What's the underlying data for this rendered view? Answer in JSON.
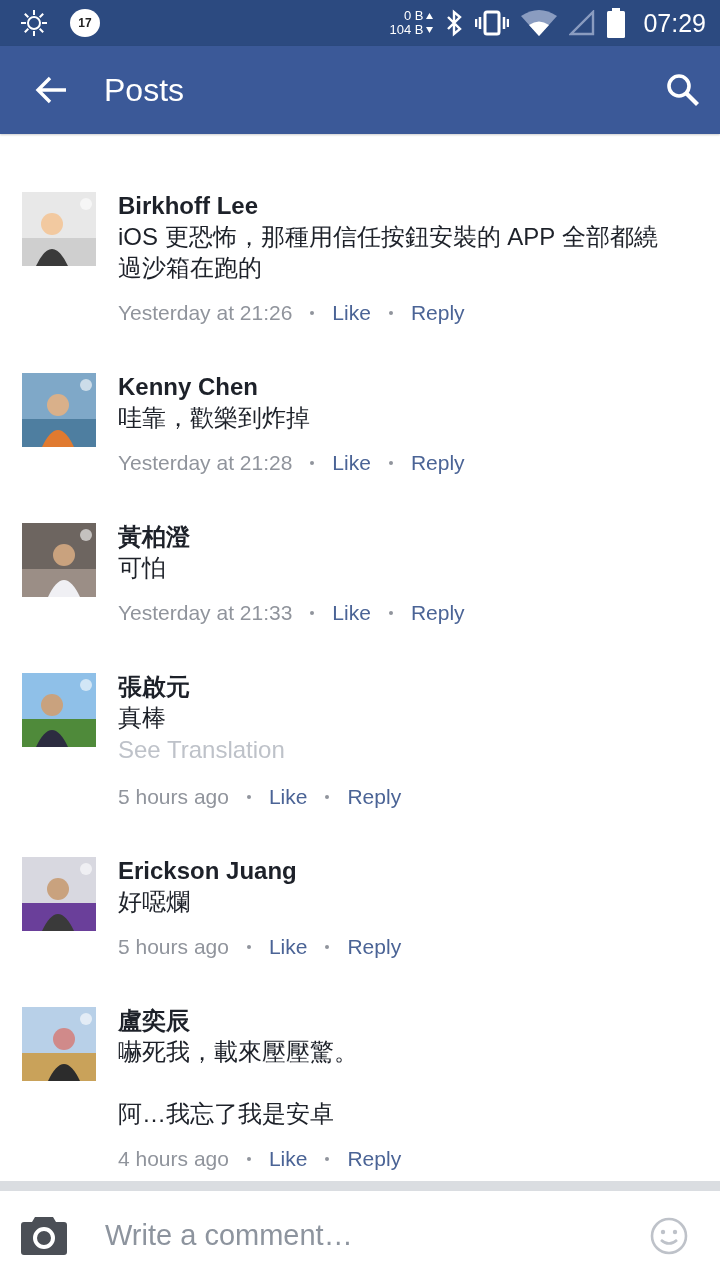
{
  "status_bar": {
    "notification_count": "17",
    "upload": "0 B",
    "download": "104 B",
    "time": "07:29"
  },
  "app_bar": {
    "title": "Posts"
  },
  "comments": [
    {
      "author": "Birkhoff Lee",
      "paragraphs": [
        "iOS 更恐怖，那種用信任按鈕安裝的 APP 全部都繞過沙箱在跑的"
      ],
      "time": "Yesterday at 21:26",
      "like": "Like",
      "reply": "Reply"
    },
    {
      "author": "Kenny Chen",
      "paragraphs": [
        "哇靠，歡樂到炸掉"
      ],
      "time": "Yesterday at 21:28",
      "like": "Like",
      "reply": "Reply"
    },
    {
      "author": "黃柏澄",
      "paragraphs": [
        "可怕"
      ],
      "time": "Yesterday at 21:33",
      "like": "Like",
      "reply": "Reply"
    },
    {
      "author": "張啟元",
      "paragraphs": [
        "真棒"
      ],
      "translation": "See Translation",
      "time": "5 hours ago",
      "like": "Like",
      "reply": "Reply"
    },
    {
      "author": "Erickson Juang",
      "paragraphs": [
        "好噁爛"
      ],
      "time": "5 hours ago",
      "like": "Like",
      "reply": "Reply"
    },
    {
      "author": "盧奕辰",
      "paragraphs": [
        "嚇死我，載來壓壓驚。",
        "阿…我忘了我是安卓"
      ],
      "time": "4 hours ago",
      "like": "Like",
      "reply": "Reply"
    }
  ],
  "composer": {
    "placeholder": "Write a comment…"
  }
}
